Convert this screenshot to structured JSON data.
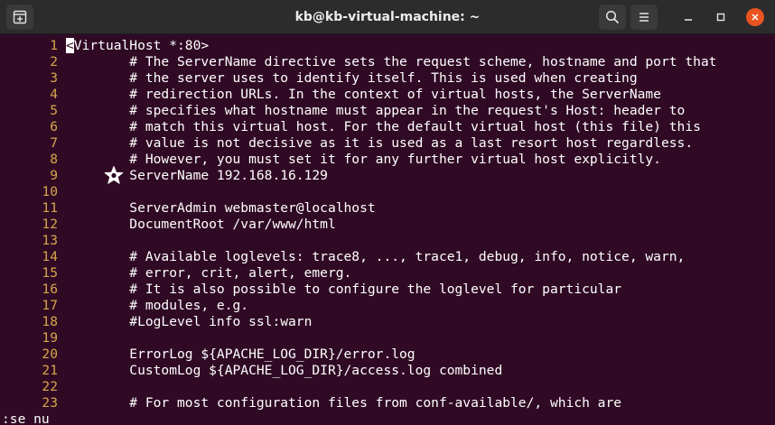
{
  "titlebar": {
    "title": "kb@kb-virtual-machine: ~",
    "new_tab_icon": "new-tab-icon",
    "search_icon": "search-icon",
    "menu_icon": "hamburger-menu-icon",
    "minimize_icon": "minimize-icon",
    "maximize_icon": "maximize-icon",
    "close_icon": "close-icon",
    "close_color": "#e95420"
  },
  "colors": {
    "terminal_background": "#300a24",
    "line_number": "#d7a64c",
    "text": "#ffffff"
  },
  "editor": {
    "lines": [
      {
        "num": "1",
        "cursor": "<",
        "text": "VirtualHost *:80>"
      },
      {
        "num": "2",
        "text": "        # The ServerName directive sets the request scheme, hostname and port that"
      },
      {
        "num": "3",
        "text": "        # the server uses to identify itself. This is used when creating"
      },
      {
        "num": "4",
        "text": "        # redirection URLs. In the context of virtual hosts, the ServerName"
      },
      {
        "num": "5",
        "text": "        # specifies what hostname must appear in the request's Host: header to"
      },
      {
        "num": "6",
        "text": "        # match this virtual host. For the default virtual host (this file) this"
      },
      {
        "num": "7",
        "text": "        # value is not decisive as it is used as a last resort host regardless."
      },
      {
        "num": "8",
        "text": "        # However, you must set it for any further virtual host explicitly."
      },
      {
        "num": "9",
        "text": "        ServerName 192.168.16.129"
      },
      {
        "num": "10",
        "text": ""
      },
      {
        "num": "11",
        "text": "        ServerAdmin webmaster@localhost"
      },
      {
        "num": "12",
        "text": "        DocumentRoot /var/www/html"
      },
      {
        "num": "13",
        "text": ""
      },
      {
        "num": "14",
        "text": "        # Available loglevels: trace8, ..., trace1, debug, info, notice, warn,"
      },
      {
        "num": "15",
        "text": "        # error, crit, alert, emerg."
      },
      {
        "num": "16",
        "text": "        # It is also possible to configure the loglevel for particular"
      },
      {
        "num": "17",
        "text": "        # modules, e.g."
      },
      {
        "num": "18",
        "text": "        #LogLevel info ssl:warn"
      },
      {
        "num": "19",
        "text": ""
      },
      {
        "num": "20",
        "text": "        ErrorLog ${APACHE_LOG_DIR}/error.log"
      },
      {
        "num": "21",
        "text": "        CustomLog ${APACHE_LOG_DIR}/access.log combined"
      },
      {
        "num": "22",
        "text": ""
      },
      {
        "num": "23",
        "text": "        # For most configuration files from conf-available/, which are"
      }
    ],
    "command_line": ":se nu",
    "annotation_icon": "star-icon"
  }
}
